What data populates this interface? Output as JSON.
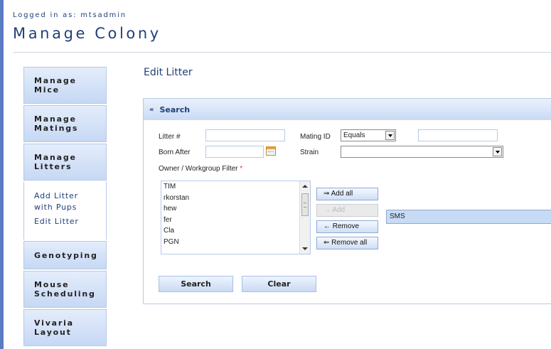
{
  "header": {
    "logged_in_text": "Logged in as: mtsadmin",
    "app_title": "Manage Colony"
  },
  "sidebar": {
    "items": [
      {
        "label_line1": "Manage",
        "label_line2": "Mice"
      },
      {
        "label_line1": "Manage",
        "label_line2": "Matings"
      },
      {
        "label_line1": "Manage",
        "label_line2": "Litters"
      }
    ],
    "subitems": [
      {
        "label_line1": "Add Litter",
        "label_line2": "with Pups"
      },
      {
        "label": "Edit Litter"
      }
    ],
    "items_after": [
      {
        "label_line1": "Genotyping"
      },
      {
        "label_line1": "Mouse",
        "label_line2": "Scheduling"
      },
      {
        "label_line1": "Vivaria",
        "label_line2": "Layout"
      }
    ]
  },
  "page": {
    "heading": "Edit Litter"
  },
  "search_panel": {
    "title": "Search",
    "litter_label": "Litter #",
    "litter_value": "",
    "mating_id_label": "Mating ID",
    "mating_operator": "Equals",
    "mating_id_value": "",
    "born_after_label": "Born After",
    "born_after_value": "",
    "strain_label": "Strain",
    "strain_value": "",
    "owner_filter_label": "Owner / Workgroup Filter",
    "required_mark": "*",
    "available_owners": [
      "TIM",
      "rkorstan",
      "hew",
      "fer",
      "Cla",
      "PGN"
    ],
    "selected_owners": [
      "SMS"
    ],
    "buttons": {
      "add_all": "⇒ Add all",
      "add": "→ Add",
      "remove": "← Remove",
      "remove_all": "⇐ Remove all"
    },
    "search_button": "Search",
    "clear_button": "Clear"
  }
}
